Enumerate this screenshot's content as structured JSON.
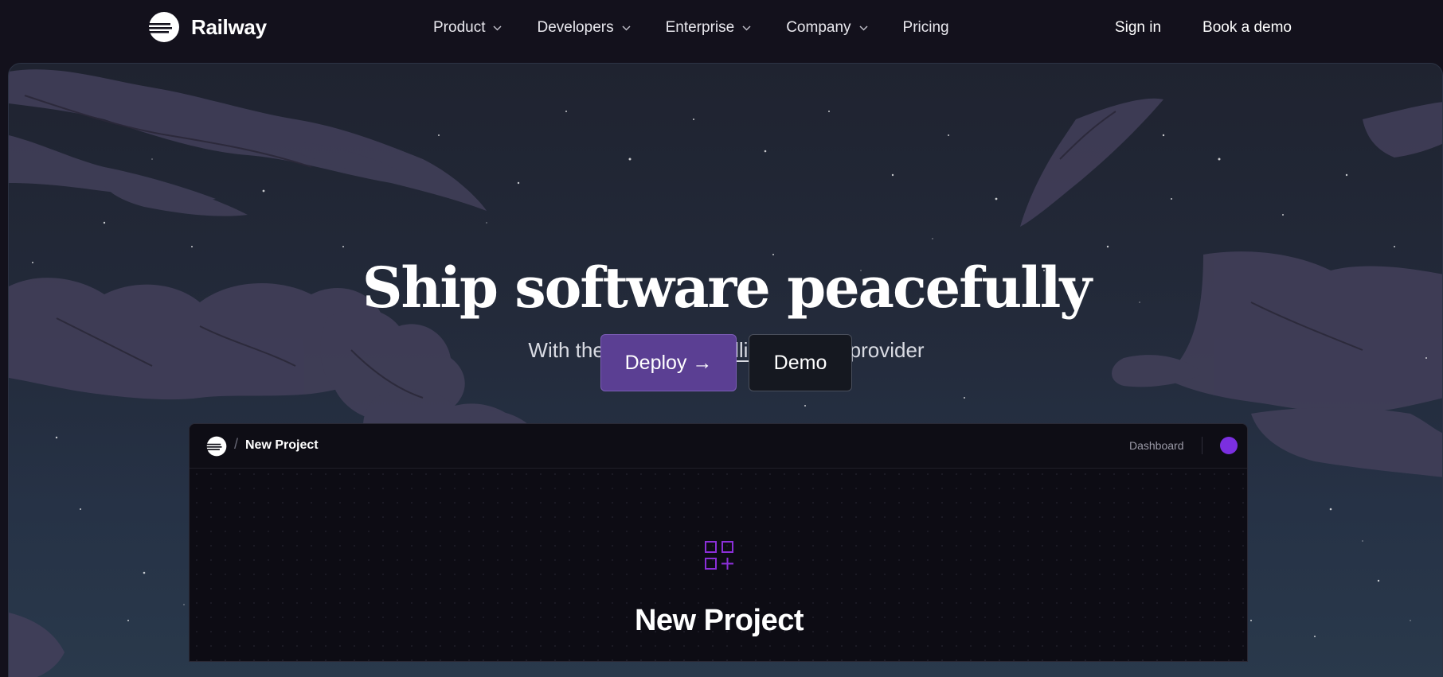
{
  "nav": {
    "brand": "Railway",
    "links": [
      {
        "label": "Product",
        "has_menu": true
      },
      {
        "label": "Developers",
        "has_menu": true
      },
      {
        "label": "Enterprise",
        "has_menu": true
      },
      {
        "label": "Company",
        "has_menu": true
      },
      {
        "label": "Pricing",
        "has_menu": false
      }
    ],
    "sign_in": "Sign in",
    "book_demo": "Book a demo"
  },
  "hero": {
    "title": "Ship software peacefully",
    "subtitle_before": "With the all-in-one ",
    "subtitle_highlight": "intelligent",
    "subtitle_after": " cloud provider",
    "deploy_button": "Deploy →",
    "demo_button": "Demo"
  },
  "preview": {
    "breadcrumb_separator": "/",
    "project_title": "New Project",
    "dashboard_link": "Dashboard",
    "heading": "New Project",
    "icon": "add-grid-icon"
  },
  "colors": {
    "background": "#13111c",
    "accent_purple": "#5b3f93",
    "avatar_purple": "#7b2fe0",
    "icon_purple": "#8b2fd8"
  }
}
